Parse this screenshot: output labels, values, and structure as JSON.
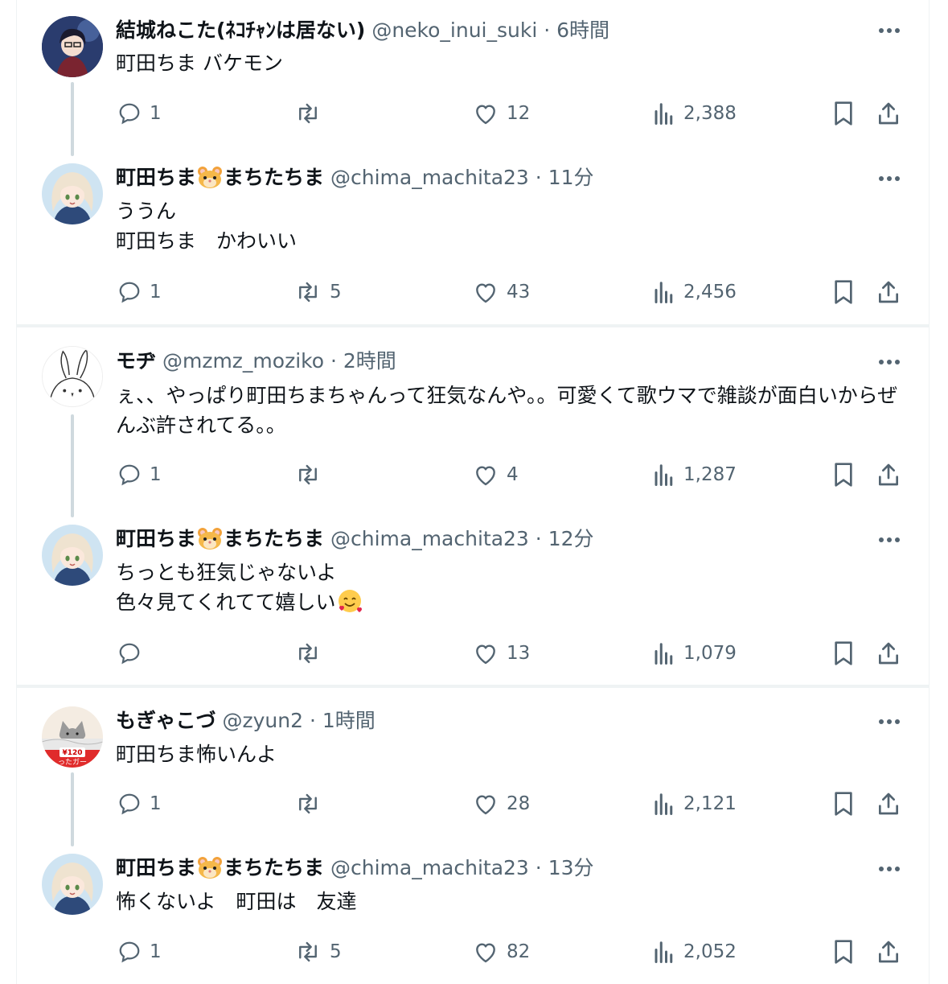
{
  "posts": [
    {
      "name": "結城ねこた(ﾈｺﾁｬﾝは居ない)",
      "handle": "@neko_inui_suki",
      "time": "6時間",
      "text": "町田ちま バケモン",
      "replies": "1",
      "reposts": "",
      "likes": "12",
      "views": "2,388",
      "avatar": "anime-boy-avatar"
    },
    {
      "name_a": "町田ちま",
      "name_b": "まちたちま",
      "handle": "@chima_machita23",
      "time": "11分",
      "text": "ううん\n町田ちま　かわいい",
      "replies": "1",
      "reposts": "5",
      "likes": "43",
      "views": "2,456",
      "avatar": "anime-girl-avatar"
    },
    {
      "name": "モヂ",
      "handle": "@mzmz_moziko",
      "time": "2時間",
      "text": "ぇ、、やっぱり町田ちまちゃんって狂気なんや。。可愛くて歌ウマで雑談が面白いからぜんぶ許されてる。。",
      "replies": "1",
      "reposts": "",
      "likes": "4",
      "views": "1,287",
      "avatar": "rabbit-avatar"
    },
    {
      "name_a": "町田ちま",
      "name_b": "まちたちま",
      "handle": "@chima_machita23",
      "time": "12分",
      "text": "ちっとも狂気じゃないよ\n色々見てくれてて嬉しい",
      "replies": "",
      "reposts": "",
      "likes": "13",
      "views": "1,079",
      "avatar": "anime-girl-avatar",
      "emoji": "smiling-face-with-hearts"
    },
    {
      "name": "もぎゃこづ",
      "handle": "@zyun2",
      "time": "1時間",
      "text": "町田ちま怖いんよ",
      "replies": "1",
      "reposts": "",
      "likes": "28",
      "views": "2,121",
      "avatar": "cat-label-avatar",
      "avatar_text": "¥120",
      "avatar_text2": "ったガー"
    },
    {
      "name_a": "町田ちま",
      "name_b": "まちたちま",
      "handle": "@chima_machita23",
      "time": "13分",
      "text": "怖くないよ　町田は　友達",
      "replies": "1",
      "reposts": "5",
      "likes": "82",
      "views": "2,052",
      "avatar": "anime-girl-avatar"
    }
  ],
  "dot": "·",
  "colors": {
    "text": "#0f1419",
    "muted": "#536471",
    "thread": "#cfd9de",
    "divider": "#eff3f4"
  }
}
